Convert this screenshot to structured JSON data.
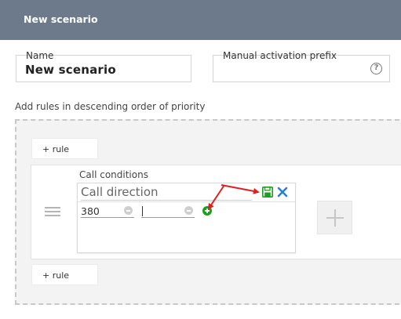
{
  "header": {
    "title": "New scenario"
  },
  "form": {
    "name_label": "Name",
    "name_value": "New scenario",
    "prefix_label": "Manual activation prefix",
    "prefix_value": "",
    "help_glyph": "?"
  },
  "rules": {
    "caption": "Add rules in descending order of priority",
    "add_rule_label": "+ rule",
    "rule": {
      "conditions_label": "Call conditions",
      "condition_type": "Call direction",
      "range_from": "380",
      "range_to": ""
    }
  },
  "colors": {
    "header_bg": "#6c7a8c",
    "save_green": "#1f9d1f",
    "close_blue": "#2a7fd4",
    "annotation_red": "#e02020"
  },
  "icons": [
    "help-icon",
    "drag-handle-icon",
    "save-icon",
    "close-icon",
    "minus-icon",
    "add-icon",
    "plus-icon"
  ]
}
